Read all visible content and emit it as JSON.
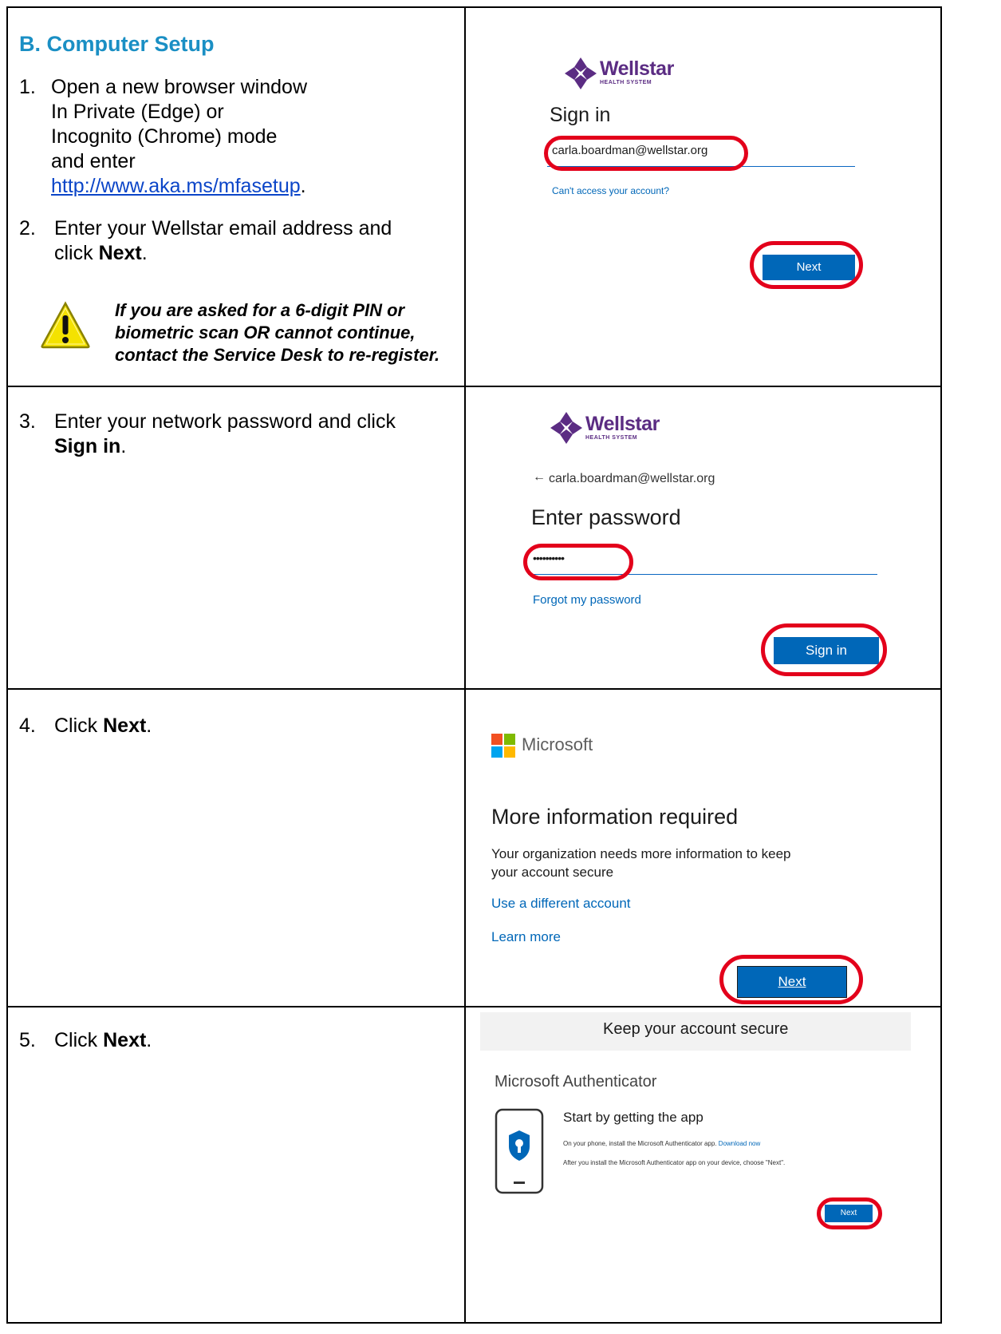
{
  "section": {
    "heading": "B.  Computer Setup"
  },
  "steps": [
    {
      "num": "1.",
      "lines": [
        "Open a new browser window",
        "In Private (Edge) or",
        "Incognito (Chrome) mode",
        "and enter"
      ],
      "link": "http://www.aka.ms/mfasetup",
      "after": "."
    },
    {
      "num": "2.",
      "text": "Enter your Wellstar email address and",
      "text2_pre": "click ",
      "text2_bold": "Next",
      "text2_post": "."
    },
    {
      "num": "3.",
      "text": "Enter your network password and click",
      "text2_bold": "Sign in",
      "text2_post": "."
    },
    {
      "num": "4.",
      "pre": "Click ",
      "bold": "Next",
      "post": "."
    },
    {
      "num": "5.",
      "pre": "Click ",
      "bold": "Next",
      "post": "."
    }
  ],
  "warning": {
    "icon": "warning-icon",
    "text": "If you are asked for a 6-digit PIN or biometric scan OR cannot continue, contact the Service Desk to re-register."
  },
  "shot1": {
    "brand": "Wellstar",
    "brand_sub": "HEALTH SYSTEM",
    "title": "Sign in",
    "email_value": "carla.boardman@wellstar.org",
    "link": "Can't access your account?",
    "button": "Next"
  },
  "shot2": {
    "brand": "Wellstar",
    "brand_sub": "HEALTH SYSTEM",
    "back_arrow": "←",
    "identity": "carla.boardman@wellstar.org",
    "title": "Enter password",
    "password_mask": "••••••••••",
    "link": "Forgot my password",
    "button": "Sign in"
  },
  "shot3": {
    "brand": "Microsoft",
    "title": "More information required",
    "body": [
      "Your organization needs more information to keep",
      "your account secure"
    ],
    "link1": "Use a different account",
    "link2": "Learn more",
    "button": "Next"
  },
  "shot4": {
    "header": "Keep your account secure",
    "subtitle": "Microsoft Authenticator",
    "heading": "Start by getting the app",
    "line1": "On your phone, install the Microsoft Authenticator app.",
    "line1_link": "Download now",
    "line2": "After you install the Microsoft Authenticator app on your device, choose \"Next\".",
    "button": "Next"
  },
  "colors": {
    "heading": "#1a8fc4",
    "ring": "#e3001b",
    "ms_blue": "#0067b8",
    "wellstar_purple": "#5b2c83"
  }
}
